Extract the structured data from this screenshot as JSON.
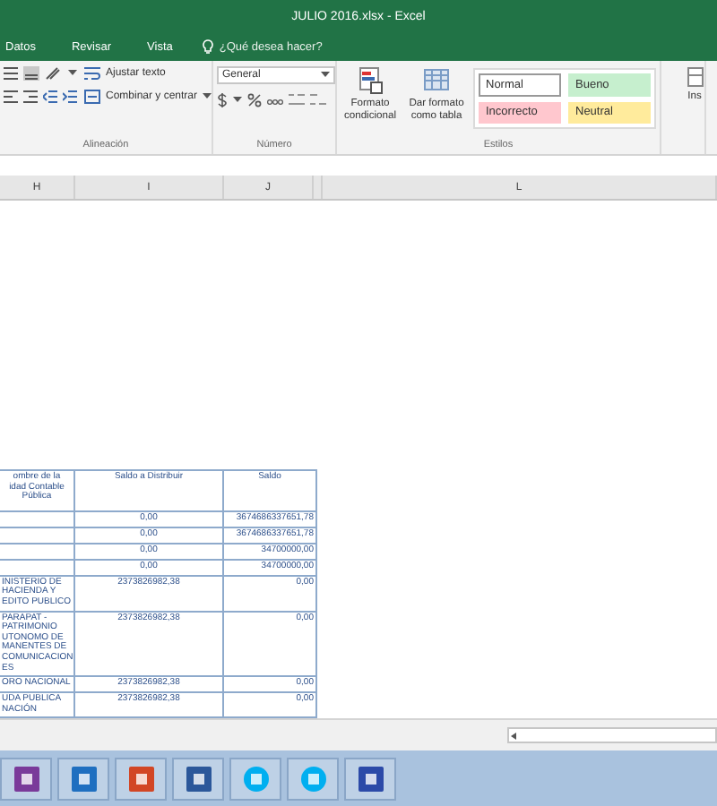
{
  "window": {
    "title": "JULIO 2016.xlsx - Excel"
  },
  "tabs": [
    {
      "label": "Datos",
      "selected": false
    },
    {
      "label": "Revisar",
      "selected": false
    },
    {
      "label": "Vista",
      "selected": false
    }
  ],
  "tell_me": {
    "placeholder": "¿Qué desea hacer?"
  },
  "ribbon": {
    "alignment": {
      "wrap_text": "Ajustar texto",
      "merge_center": "Combinar y centrar",
      "label": "Alineación"
    },
    "number": {
      "format": "General",
      "label": "Número"
    },
    "styles": {
      "conditional_format": "Formato condicional",
      "format_table": "Dar formato como tabla",
      "label": "Estilos",
      "cells": [
        {
          "label": "Normal",
          "color": "#ffffff"
        },
        {
          "label": "Bueno",
          "color": "#c6efce"
        },
        {
          "label": "Incorrecto",
          "color": "#ffc7ce"
        },
        {
          "label": "Neutral",
          "color": "#ffeb9c"
        }
      ]
    },
    "insert": "Ins"
  },
  "columns": [
    {
      "label": "H"
    },
    {
      "label": "I"
    },
    {
      "label": "J"
    },
    {
      "label": "L"
    }
  ],
  "table": {
    "headers": [
      "ombre de la\nidad Contable\nPública",
      "Saldo a Distribuir",
      "Saldo"
    ],
    "rows": [
      [
        "",
        "0,00",
        "3674686337651,78"
      ],
      [
        "",
        "0,00",
        "3674686337651,78"
      ],
      [
        "",
        "0,00",
        "34700000,00"
      ],
      [
        "",
        "0,00",
        "34700000,00"
      ],
      [
        "INISTERIO DE\nHACIENDA Y\nEDITO PUBLICO",
        "2373826982,38",
        "0,00"
      ],
      [
        "PARAPAT -\nPATRIMONIO\nUTONOMO DE\nMANENTES DE\nCOMUNICACION\nES",
        "2373826982,38",
        "0,00"
      ],
      [
        "ORO NACIONAL",
        "2373826982,38",
        "0,00"
      ],
      [
        "UDA PUBLICA\nNACIÓN",
        "2373826982,38",
        "0,00"
      ]
    ]
  }
}
